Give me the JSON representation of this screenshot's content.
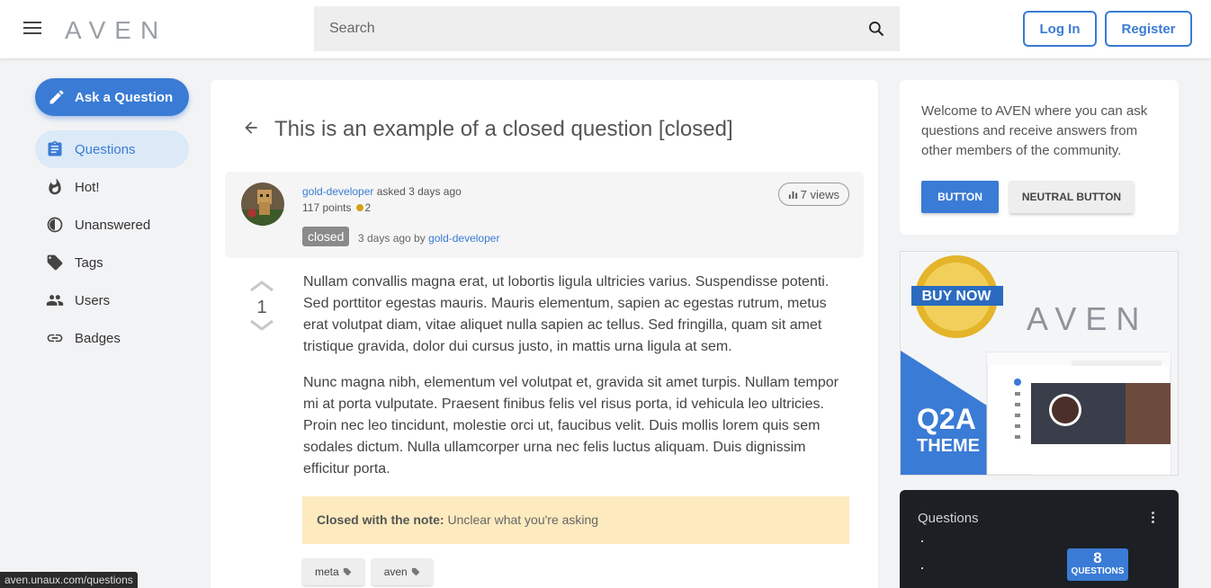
{
  "header": {
    "logo": "AVEN",
    "search_placeholder": "Search",
    "login_label": "Log In",
    "register_label": "Register"
  },
  "sidebar": {
    "ask_label": "Ask a Question",
    "items": [
      {
        "label": "Questions",
        "icon": "clipboard-icon"
      },
      {
        "label": "Hot!",
        "icon": "flame-icon"
      },
      {
        "label": "Unanswered",
        "icon": "clock-icon"
      },
      {
        "label": "Tags",
        "icon": "tag-icon"
      },
      {
        "label": "Users",
        "icon": "users-icon"
      },
      {
        "label": "Badges",
        "icon": "link-icon"
      }
    ]
  },
  "question": {
    "title": "This is an example of a closed question [closed]",
    "author": "gold-developer",
    "asked_text": "asked 3 days ago",
    "points": "117 points",
    "badge_count": "2",
    "views": "7 views",
    "closed_label": "closed",
    "closed_when": "3 days ago by",
    "closed_by": "gold-developer",
    "votes": "1",
    "paragraphs": [
      "Nullam convallis magna erat, ut lobortis ligula ultricies varius. Suspendisse potenti. Sed porttitor egestas mauris. Mauris elementum, sapien ac egestas rutrum, metus erat volutpat diam, vitae aliquet nulla sapien ac tellus. Sed fringilla, quam sit amet tristique gravida, dolor dui cursus justo, in mattis urna ligula at sem.",
      "Nunc magna nibh, elementum vel volutpat et, gravida sit amet turpis. Nullam tempor mi at porta vulputate. Praesent finibus felis vel risus porta, id vehicula leo ultricies. Proin nec leo tincidunt, molestie orci ut, faucibus velit. Duis mollis lorem quis sem sodales dictum. Nulla ullamcorper urna nec felis luctus aliquam. Duis dignissim efficitur porta."
    ],
    "closed_note_label": "Closed with the note:",
    "closed_note_text": "Unclear what you're asking",
    "tags": [
      "meta",
      "aven"
    ]
  },
  "welcome": {
    "text": "Welcome to AVEN where you can ask questions and receive answers from other members of the community.",
    "button_label": "BUTTON",
    "neutral_label": "NEUTRAL BUTTON"
  },
  "ad": {
    "logo": "AVEN",
    "q2a": "Q2A",
    "theme": "THEME",
    "seal": "BUY NOW"
  },
  "stats": {
    "title": "Questions",
    "count": "8",
    "count_label": "QUESTIONS"
  },
  "status_url": "aven.unaux.com/questions",
  "colors": {
    "accent": "#3a7bd5",
    "closed_note_bg": "#fdebbf",
    "stats_bg": "#1c1f24"
  }
}
